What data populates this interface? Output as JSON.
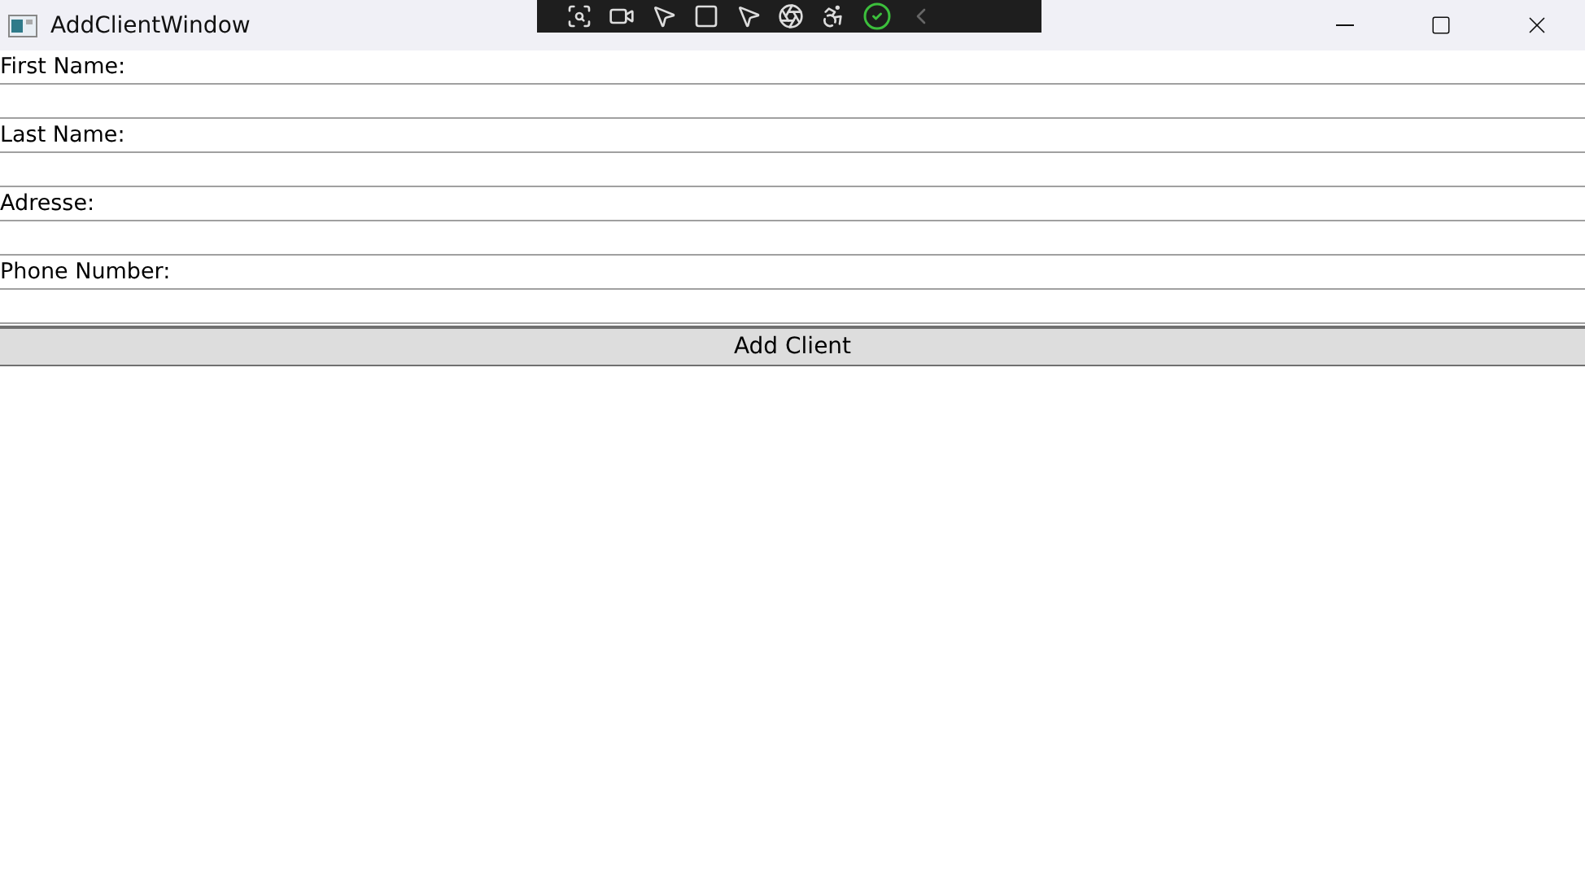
{
  "window": {
    "title": "AddClientWindow"
  },
  "fields": [
    {
      "label": "First Name:"
    },
    {
      "label": "Last Name:"
    },
    {
      "label": "Adresse:"
    },
    {
      "label": "Phone Number:"
    }
  ],
  "button": "Add Client"
}
